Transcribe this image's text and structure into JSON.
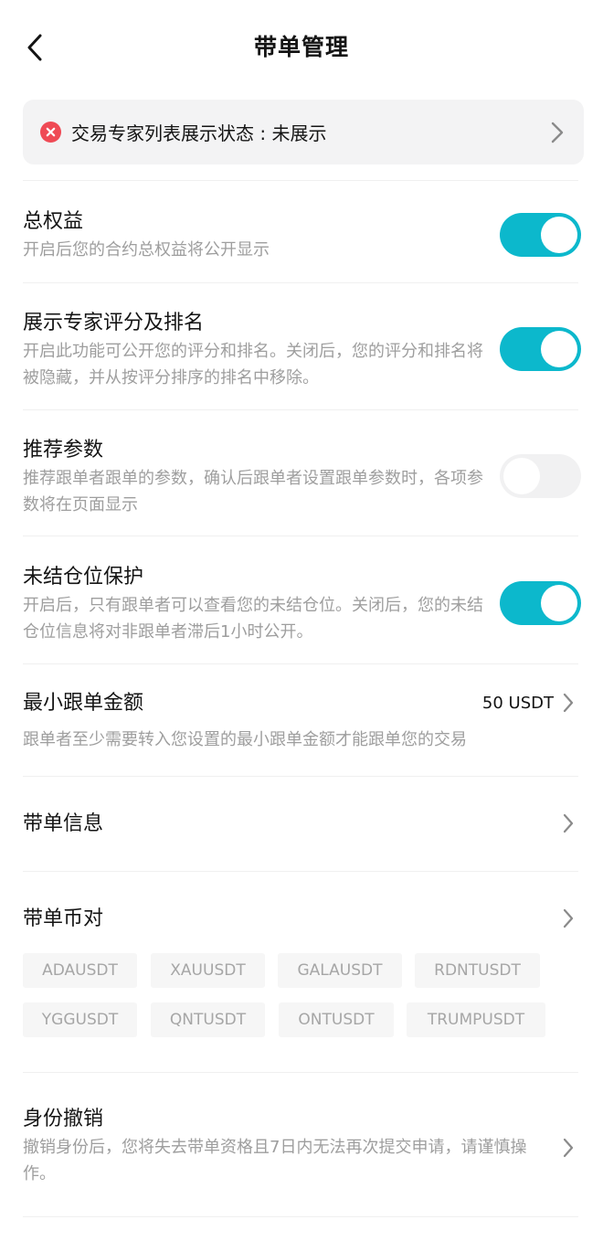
{
  "header": {
    "title": "带单管理"
  },
  "status_banner": {
    "text": "交易专家列表展示状态 : 未展示"
  },
  "settings": {
    "total_equity": {
      "title": "总权益",
      "desc": "开启后您的合约总权益将公开显示",
      "enabled": true
    },
    "expert_rank": {
      "title": "展示专家评分及排名",
      "desc": "开启此功能可公开您的评分和排名。关闭后，您的评分和排名将被隐藏，并从按评分排序的排名中移除。",
      "enabled": true
    },
    "recommend_params": {
      "title": "推荐参数",
      "desc": "推荐跟单者跟单的参数，确认后跟单者设置跟单参数时，各项参数将在页面显示",
      "enabled": false
    },
    "open_position": {
      "title": "未结仓位保护",
      "desc": "开启后，只有跟单者可以查看您的未结仓位。关闭后，您的未结仓位信息将对非跟单者滞后1小时公开。",
      "enabled": true
    }
  },
  "min_amount": {
    "title": "最小跟单金额",
    "value": "50 USDT",
    "desc": "跟单者至少需要转入您设置的最小跟单金额才能跟单您的交易"
  },
  "lead_info": {
    "title": "带单信息"
  },
  "pairs": {
    "title": "带单币对",
    "items": [
      "ADAUSDT",
      "XAUUSDT",
      "GALAUSDT",
      "RDNTUSDT",
      "YGGUSDT",
      "QNTUSDT",
      "ONTUSDT",
      "TRUMPUSDT"
    ]
  },
  "revoke": {
    "title": "身份撤销",
    "desc": "撤销身份后，您将失去带单资格且7日内无法再次提交申请，请谨慎操作。"
  },
  "colors": {
    "accent": "#0cb8cc",
    "error": "#ef4a55",
    "muted": "#9e9e9e"
  }
}
